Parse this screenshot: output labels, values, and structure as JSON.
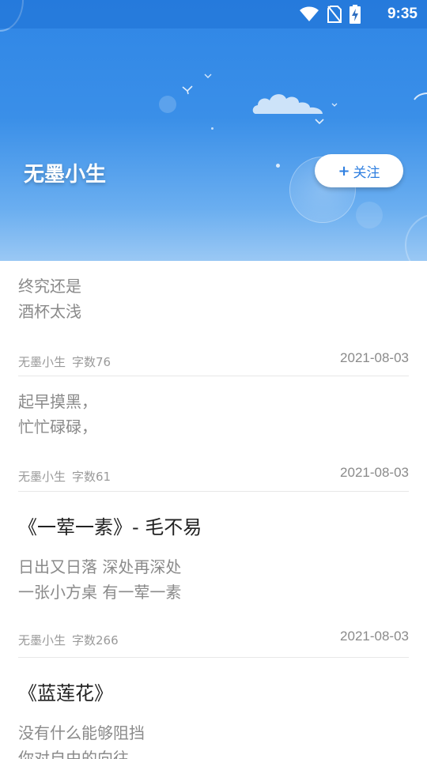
{
  "status_bar": {
    "time": "9:35",
    "icons": [
      "wifi-icon",
      "no-sim-icon",
      "battery-charging-icon"
    ]
  },
  "header": {
    "author_name": "无墨小生",
    "follow_button": {
      "plus": "+",
      "label": "关注"
    }
  },
  "articles": [
    {
      "title": "",
      "lines": [
        "终究还是",
        "酒杯太浅"
      ],
      "author": "无墨小生",
      "word_count": "字数76",
      "date": "2021-08-03"
    },
    {
      "title": "",
      "lines": [
        "起早摸黑，",
        "忙忙碌碌，"
      ],
      "author": "无墨小生",
      "word_count": "字数61",
      "date": "2021-08-03"
    },
    {
      "title": "《一荤一素》- 毛不易",
      "lines": [
        "日出又日落 深处再深处",
        "一张小方桌 有一荤一素"
      ],
      "author": "无墨小生",
      "word_count": "字数266",
      "date": "2021-08-03"
    },
    {
      "title": "《蓝莲花》",
      "lines": [
        "没有什么能够阻挡",
        "你对自由的向往"
      ],
      "author": "",
      "word_count": "",
      "date": ""
    }
  ],
  "colors": {
    "header_blue": "#2f86e6",
    "accent": "#2f7fe0",
    "excerpt_gray": "#8a8a8a"
  }
}
